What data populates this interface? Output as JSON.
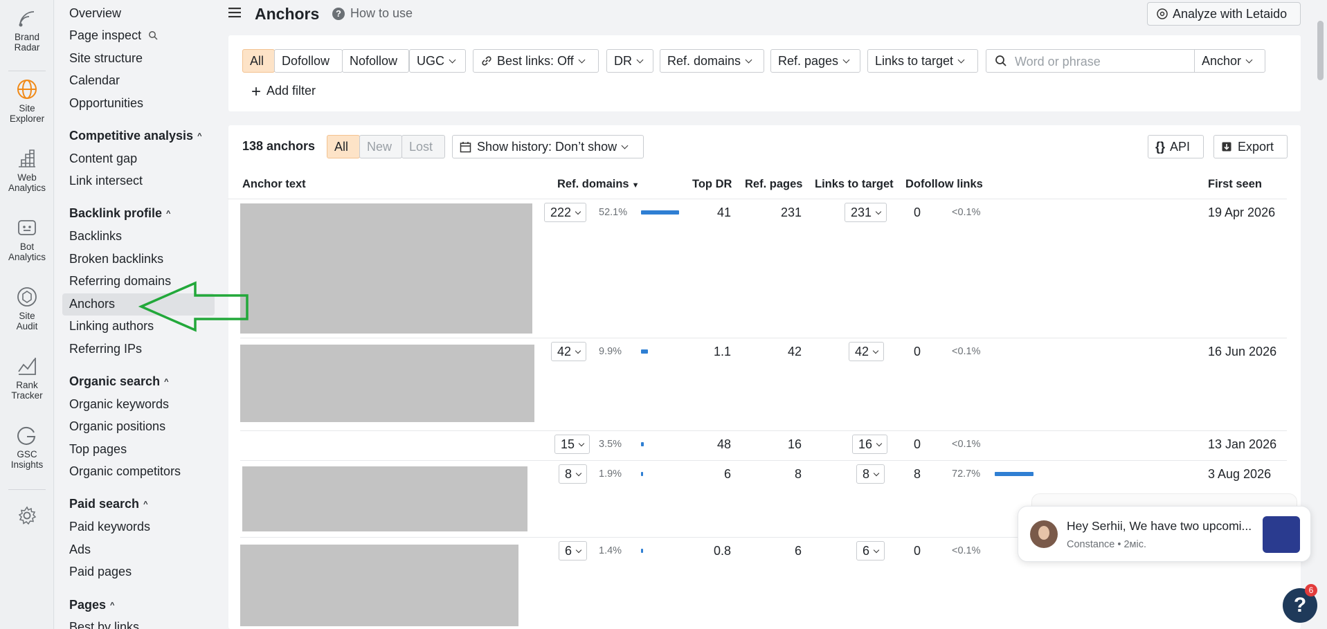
{
  "rail": [
    {
      "name": "brand-radar",
      "label1": "Brand",
      "label2": "Radar"
    },
    {
      "name": "site-explorer",
      "label1": "Site",
      "label2": "Explorer"
    },
    {
      "name": "web-analytics",
      "label1": "Web",
      "label2": "Analytics"
    },
    {
      "name": "bot-analytics",
      "label1": "Bot",
      "label2": "Analytics"
    },
    {
      "name": "site-audit",
      "label1": "Site",
      "label2": "Audit"
    },
    {
      "name": "rank-tracker",
      "label1": "Rank",
      "label2": "Tracker"
    },
    {
      "name": "gsc-insights",
      "label1": "GSC",
      "label2": "Insights"
    }
  ],
  "nav": {
    "overview": "Overview",
    "page_inspect": "Page inspect",
    "site_structure": "Site structure",
    "calendar": "Calendar",
    "opportunities": "Opportunities",
    "competitive_analysis": "Competitive analysis",
    "content_gap": "Content gap",
    "link_intersect": "Link intersect",
    "backlink_profile": "Backlink profile",
    "backlinks": "Backlinks",
    "broken_backlinks": "Broken backlinks",
    "referring_domains": "Referring domains",
    "anchors": "Anchors",
    "linking_authors": "Linking authors",
    "referring_ips": "Referring IPs",
    "organic_search": "Organic search",
    "organic_keywords": "Organic keywords",
    "organic_positions": "Organic positions",
    "top_pages": "Top pages",
    "organic_competitors": "Organic competitors",
    "paid_search": "Paid search",
    "paid_keywords": "Paid keywords",
    "ads": "Ads",
    "paid_pages": "Paid pages",
    "pages": "Pages",
    "best_by_links": "Best by links"
  },
  "header": {
    "title": "Anchors",
    "how_to_use": "How to use",
    "analyze": "Analyze with Letaido"
  },
  "filters": {
    "all": "All",
    "dofollow": "Dofollow",
    "nofollow": "Nofollow",
    "ugc": "UGC",
    "best_links": "Best links: Off",
    "dr": "DR",
    "ref_domains": "Ref. domains",
    "ref_pages": "Ref. pages",
    "links_to_target": "Links to target",
    "search_placeholder": "Word or phrase",
    "anchor_select": "Anchor",
    "add_filter": "Add filter"
  },
  "results": {
    "count": "138 anchors",
    "tab_all": "All",
    "tab_new": "New",
    "tab_lost": "Lost",
    "history": "Show history: Don’t show",
    "api": "API",
    "export": "Export"
  },
  "columns": {
    "anchor_text": "Anchor text",
    "ref_domains": "Ref. domains",
    "top_dr": "Top DR",
    "ref_pages": "Ref. pages",
    "links_to_target": "Links to target",
    "dofollow_links": "Dofollow links",
    "first_seen": "First seen"
  },
  "rows": [
    {
      "ref_domains": "222",
      "pct": "52.1%",
      "share": 0.521,
      "top_dr": "41",
      "ref_pages": "231",
      "links": "231",
      "dofollow": "0",
      "dofollow_pct": "<0.1%",
      "dofollow_share": 0,
      "first_seen": "19 Apr 2026"
    },
    {
      "ref_domains": "42",
      "pct": "9.9%",
      "share": 0.099,
      "top_dr": "1.1",
      "ref_pages": "42",
      "links": "42",
      "dofollow": "0",
      "dofollow_pct": "<0.1%",
      "dofollow_share": 0,
      "first_seen": "16 Jun 2026"
    },
    {
      "ref_domains": "15",
      "pct": "3.5%",
      "share": 0.035,
      "top_dr": "48",
      "ref_pages": "16",
      "links": "16",
      "dofollow": "0",
      "dofollow_pct": "<0.1%",
      "dofollow_share": 0,
      "first_seen": "13 Jan 2026"
    },
    {
      "ref_domains": "8",
      "pct": "1.9%",
      "share": 0.019,
      "top_dr": "6",
      "ref_pages": "8",
      "links": "8",
      "dofollow": "8",
      "dofollow_pct": "72.7%",
      "dofollow_share": 0.727,
      "first_seen": "3 Aug 2026"
    },
    {
      "ref_domains": "6",
      "pct": "1.4%",
      "share": 0.014,
      "top_dr": "0.8",
      "ref_pages": "6",
      "links": "6",
      "dofollow": "0",
      "dofollow_pct": "<0.1%",
      "dofollow_share": 0,
      "first_seen": ""
    }
  ],
  "chat": {
    "message": "Hey Serhii, We have two upcomi...",
    "sender": "Constance • 2міс."
  },
  "help": {
    "badge": "6",
    "label": "?"
  },
  "colors": {
    "accent_bar": "#2f7fd3",
    "active_segment": "#fde3c7",
    "arrow": "#22a83a"
  }
}
